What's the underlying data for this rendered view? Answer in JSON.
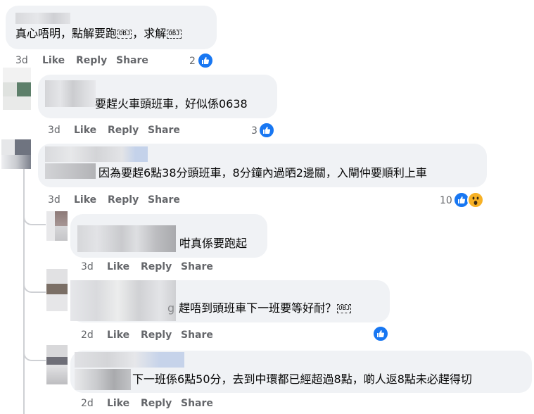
{
  "comments": [
    {
      "text": "真心唔明，點解要跑",
      "text_suffix": "，求解",
      "obj_glyph": "OBJ",
      "time": "3d",
      "like": "Like",
      "reply": "Reply",
      "share": "Share",
      "reaction_count": "2",
      "reactions": [
        "like-icon"
      ]
    },
    {
      "text": "要趕火車頭班車，好似係0638",
      "time": "3d",
      "like": "Like",
      "reply": "Reply",
      "share": "Share",
      "reaction_count": "3",
      "reactions": [
        "like-icon"
      ]
    },
    {
      "text": "因為要趕6點38分頭班車，8分鐘內過晒2邊關，入閘仲要順利上車",
      "time": "3d",
      "like": "Like",
      "reply": "Reply",
      "share": "Share",
      "reaction_count": "10",
      "reactions": [
        "like-icon",
        "wow-icon"
      ]
    }
  ],
  "replies": [
    {
      "text": "咁真係要跑起",
      "time": "3d",
      "like": "Like",
      "reply": "Reply",
      "share": "Share"
    },
    {
      "text_prefix": "g",
      "text": "趕唔到頭班車下一班要等好耐？",
      "obj_glyph": "OBJ",
      "time": "2d",
      "like": "Like",
      "reply": "Reply",
      "share": "Share",
      "reactions": [
        "like-icon"
      ]
    },
    {
      "text": "下一班係6點50分，去到中環都已經超過8點，啲人返8點未必趕得切",
      "time": "2d",
      "like": "Like",
      "reply": "Reply",
      "share": "Share"
    }
  ],
  "colors": {
    "bubble": "#f0f2f5",
    "like_blue": "#1877f2",
    "action_gray": "#65676b",
    "wow_yellow": "#f7b125"
  }
}
